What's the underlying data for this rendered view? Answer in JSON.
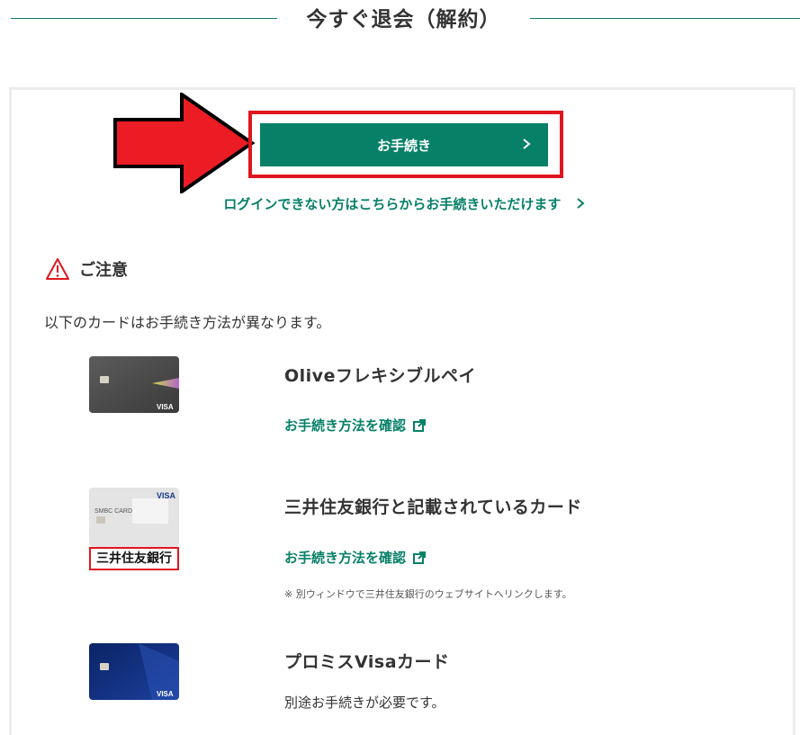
{
  "section": {
    "title": "今すぐ退会（解約）"
  },
  "procedure_button": {
    "label": "お手続き"
  },
  "login_link": {
    "label": "ログインできない方はこちらからお手続きいただけます"
  },
  "notice": {
    "title": "ご注意",
    "intro": "以下のカードはお手続き方法が異なります。"
  },
  "cards": [
    {
      "name": "Oliveフレキシブルペイ",
      "link_label": "お手続き方法を確認",
      "card_brand": "VISA"
    },
    {
      "name": "三井住友銀行と記載されているカード",
      "link_label": "お手続き方法を確認",
      "note": "※ 別ウィンドウで三井住友銀行のウェブサイトへリンクします。",
      "card_brand": "VISA",
      "card_print": "SMBC CARD",
      "bank_label": "三井住友銀行"
    },
    {
      "name": "プロミスVisaカード",
      "text": "別途お手続きが必要です。",
      "card_brand": "VISA"
    }
  ],
  "colors": {
    "primary": "#078068",
    "highlight": "#e0161e",
    "text": "#333333"
  },
  "icons": {
    "arrow": "red-arrow-right",
    "warning": "warning-triangle-icon",
    "external": "external-link-icon",
    "chevron": "chevron-right-icon"
  }
}
